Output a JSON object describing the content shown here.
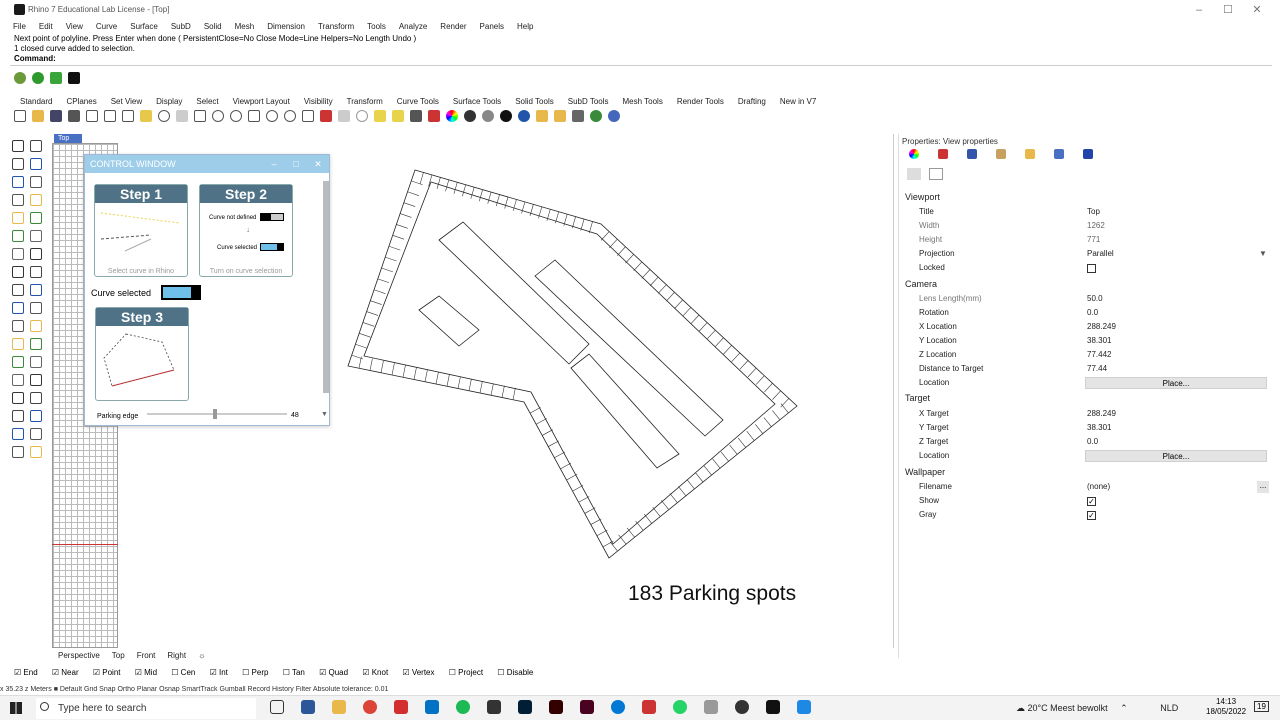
{
  "window": {
    "title": "Rhino 7 Educational Lab License - [Top]"
  },
  "menu": [
    "File",
    "Edit",
    "View",
    "Curve",
    "Surface",
    "SubD",
    "Solid",
    "Mesh",
    "Dimension",
    "Transform",
    "Tools",
    "Analyze",
    "Render",
    "Panels",
    "Help"
  ],
  "command": {
    "line1": "Next point of polyline. Press Enter when done ( PersistentClose=No  Close  Mode=Line  Helpers=No  Length  Undo )",
    "line2": "1 closed curve added to selection.",
    "prompt": "Command:"
  },
  "toolbar_tabs": [
    "Standard",
    "CPlanes",
    "Set View",
    "Display",
    "Select",
    "Viewport Layout",
    "Visibility",
    "Transform",
    "Curve Tools",
    "Surface Tools",
    "Solid Tools",
    "SubD Tools",
    "Mesh Tools",
    "Render Tools",
    "Drafting",
    "New in V7"
  ],
  "viewport": {
    "name": "Top",
    "result_text": "183 Parking spots"
  },
  "control_window": {
    "title": "CONTROL WINDOW",
    "step1": {
      "title": "Step 1",
      "caption": "Select curve in Rhino"
    },
    "step2": {
      "title": "Step 2",
      "caption": "Turn on curve selection",
      "label_a": "Curve not defined",
      "label_b": "Curve selected"
    },
    "curve_selected": "Curve selected",
    "step3": {
      "title": "Step 3"
    },
    "slider": {
      "label": "Parking edge",
      "value": "48"
    }
  },
  "properties": {
    "header": "Properties: View properties",
    "viewport_section": "Viewport",
    "title_label": "Title",
    "title_value": "Top",
    "width_label": "Width",
    "width_value": "1262",
    "height_label": "Height",
    "height_value": "771",
    "projection_label": "Projection",
    "projection_value": "Parallel",
    "locked_label": "Locked",
    "camera_section": "Camera",
    "lens_label": "Lens Length(mm)",
    "lens_value": "50.0",
    "rotation_label": "Rotation",
    "rotation_value": "0.0",
    "xloc_label": "X Location",
    "xloc_value": "288.249",
    "yloc_label": "Y Location",
    "yloc_value": "38.301",
    "zloc_label": "Z Location",
    "zloc_value": "77.442",
    "dist_label": "Distance to Target",
    "dist_value": "77.44",
    "location_label": "Location",
    "place_button": "Place...",
    "target_section": "Target",
    "xt_label": "X Target",
    "xt_value": "288.249",
    "yt_label": "Y Target",
    "yt_value": "38.301",
    "zt_label": "Z Target",
    "zt_value": "0.0",
    "tloc_label": "Location",
    "wallpaper_section": "Wallpaper",
    "filename_label": "Filename",
    "filename_value": "(none)",
    "browse": "...",
    "show_label": "Show",
    "gray_label": "Gray"
  },
  "view_tabs": [
    "Perspective",
    "Top",
    "Front",
    "Right"
  ],
  "osnaps": [
    "End",
    "Near",
    "Point",
    "Mid",
    "Cen",
    "Int",
    "Perp",
    "Tan",
    "Quad",
    "Knot",
    "Vertex",
    "Project",
    "Disable"
  ],
  "statusbar": {
    "text": "  x 35.23       z      Meters     ■ Default        Grid Snap   Ortho   Planar   Osnap   SmartTrack   Gumball   Record History   Filter   Absolute tolerance: 0.01"
  },
  "taskbar": {
    "search_placeholder": "Type here to search",
    "weather": "20°C  Meest bewolkt",
    "lang": "NLD",
    "time": "14:13",
    "date": "18/05/2022",
    "notif": "19"
  }
}
